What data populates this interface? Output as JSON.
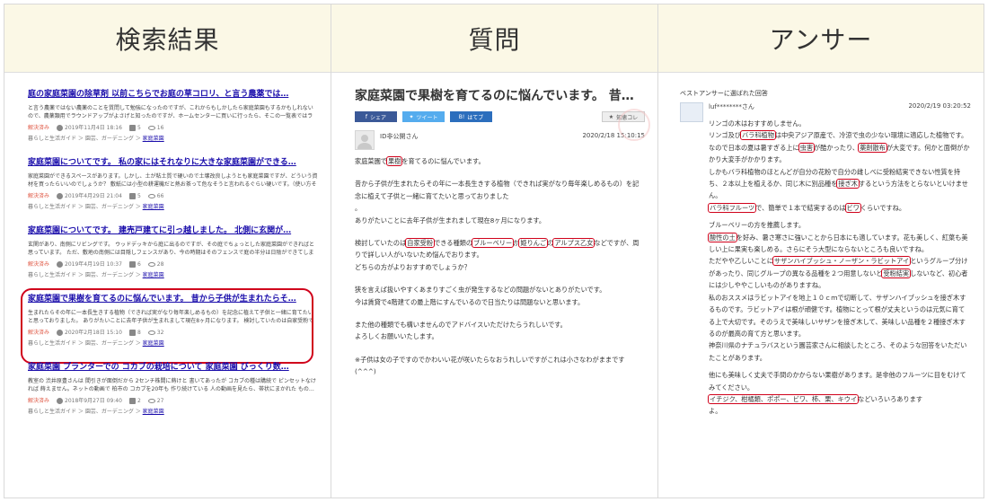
{
  "columns": {
    "results_title": "検索結果",
    "question_title": "質問",
    "answer_title": "アンサー"
  },
  "results": [
    {
      "title": "庭の家庭菜園の除草剤 以前こちらでお庭の草コロリ、と言う農薬では…",
      "snippet": "と言う農薬ではない農薬のことを質問して勉強になったのですが、これからもしかしたら家庭菜園もするかもしれないので、農薬類用でラウンドアップがよさげと知ったのですが、ホームセンターに買いに行ったら、そこの一覧表ではラウ…",
      "status": "解決済み",
      "date": "2019年11月4日 18:16",
      "answers": "5",
      "views": "16",
      "category_prefix": "暮らしと生活ガイド ＞ 園芸、ガーデニング ＞",
      "category_link": "家庭菜園"
    },
    {
      "title": "家庭菜園についてです。 私の家にはそれなりに大きな家庭菜園ができる…",
      "snippet": "家庭菜園ができるスペースがあります。しかし、土が粘土質で硬いので土壌改良しようとも家庭菜園ですが、どういう資材を買ったらいいのでしょうか？ 敷紙には小型の耕運機だと熱お茶って危なそうと言われるぐらい硬いです。（使い方その…",
      "status": "解決済み",
      "date": "2019年4月29日 21:04",
      "answers": "5",
      "views": "66",
      "category_prefix": "暮らしと生活ガイド ＞ 園芸、ガーデニング ＞",
      "category_link": "家庭菜園"
    },
    {
      "title": "家庭菜園についてです。 建売戸建てに引っ越しました。 北側に玄関が…",
      "snippet": "玄関があり、南側にリビングです。 ウッドデッキから庭に出るのですが、その庭でちょっとした家庭菜園ができればと思っています。 ただ、敷地の南側には目隠しフェンスがあり、今の時期はそのフェンスで庭の半分は日陰ができてしまいます…",
      "status": "解決済み",
      "date": "2019年4月19日 10:37",
      "answers": "6",
      "views": "28",
      "category_prefix": "暮らしと生活ガイド ＞ 園芸、ガーデニング ＞",
      "category_link": "家庭菜園"
    },
    {
      "title": "家庭菜園で果樹を育てるのに悩んでいます。 昔から子供が生まれたらそ…",
      "snippet": "生まれたらその年に一本長生きする植物（できれば実がなり毎年楽しめるもの）を記念に植えて子供と一緒に育てたいと思っておりました。 ありがたいことに去年子供が生まれまして現在8ヶ月になります。 検討していたのは自家受粉でき…",
      "status": "解決済み",
      "date": "2020年2月18日 15:10",
      "answers": "8",
      "views": "32",
      "category_prefix": "暮らしと生活ガイド ＞ 園芸、ガーデニング ＞",
      "category_link": "家庭菜園"
    },
    {
      "title": "家庭菜園 プランターでの コカブの栽培について 家庭菜園 びっくり数…",
      "snippet": "教室の 渋井原豊さんは 間引きが面倒だから 2センチ株間に蒔けと 書いてあったが コカブの種は購続で ピンセットなけ れば 蒔えません。ネットの動画で 柏市の コカブを20年も 作り続けている 人の動画を見たら、帯状にまかれた もの…",
      "status": "解決済み",
      "date": "2018年9月27日 09:40",
      "answers": "2",
      "views": "27",
      "category_prefix": "暮らしと生活ガイド ＞ 園芸、ガーデニング ＞",
      "category_link": "家庭菜園"
    }
  ],
  "question": {
    "title": "家庭菜園で果樹を育てるのに悩んでいます。 昔…",
    "share": {
      "facebook": "シェア",
      "twitter": "ツイート",
      "hatena": "はてブ",
      "save": "知恵コレ"
    },
    "username": "ID非公開さん",
    "date": "2020/2/18 15:10:15",
    "p1_pre": "家庭菜園で",
    "p1_box": "果樹",
    "p1_post": "を育てるのに悩んでいます。",
    "p2": "昔から子供が生まれたらその年に一本長生きする植物（できれば実がなり毎年楽しめるもの）を記念に植えて子供と一緒に育てたいと思っておりました",
    "p2b": "。",
    "p3": "ありがたいことに去年子供が生まれまして現在8ヶ月になります。",
    "p4_pre": "検討していたのは",
    "p4_box1": "自家受粉",
    "p4_mid1": "できる種類の",
    "p4_box2": "ブルーベリー",
    "p4_mid2": "か",
    "p4_box3": "姫りんご",
    "p4_mid3": "の",
    "p4_box4": "アルプス乙女",
    "p4_post": "などですが、周りで詳しい人がいないため悩んでおります。",
    "p4_tail": "どちらの方がよりおすすめでしょうか？",
    "p5": "狭を言えば扱いやすくあまりすごく虫が発生するなどの問題がないとありがたいです。",
    "p5b": "今は賃貸で4階建ての最上階にすんでいるので日当たりは問題ないと思います。",
    "p6": "また他の種類でも構いませんのでアドバイスいただけたらうれしいです。",
    "p6b": "よろしくお願いいたします。",
    "p7": "※子供は女の子ですのでかわいい花が咲いたらなおうれしいですがこれは小さなわがままです(^^^)"
  },
  "answer": {
    "label": "ベストアンサーに選ばれた回答",
    "username": "luf********さん",
    "date": "2020/2/19 03:20:52",
    "l1": "リンゴの木はおすすめしません。",
    "l2_pre": "リンゴ及び",
    "l2_box": "バラ科植物",
    "l2_post": "は中央アジア原産で、冷涼で虫の少ない環境に適応した植物です。なので日本の夏は暑すぎる上に",
    "l2_box2": "虫害",
    "l2_mid": "が酷かったり、",
    "l2_box3": "薬剤散布",
    "l2_post2": "が大変です。何かと面倒がかかり大変手がかかります。",
    "l3_pre": "しかもバラ科植物のほとんどが自分の花粉で自分の雌しべに受粉結実できない性質を持ち、２本以上を植えるか、同じ木に別品種を",
    "l3_box": "接ぎ木",
    "l3_post": "するという方法をとらないといけません。",
    "l4_box": "バラ科フルーツ",
    "l4_mid": "で、簡単で１本で結実するのは",
    "l4_box2": "ビワ",
    "l4_post": "くらいですね。",
    "l5": "ブルーベリーの方を推薦します。",
    "l6_box": "酸性の土",
    "l6_post": "を好み、暑さ寒さに強いことから日本にも適しています。花も美しく、紅葉も美しい上に果実も楽しめる。さらにそう大型にならないところも良いですね。",
    "l7_pre": "ただやや乙しいことに",
    "l7_box": "サザンハイブッシュ・ノーザン・ラビットアイ",
    "l7_mid": "というグループ分けがあったり、同じグループの異なる品種を２つ用意しないと",
    "l7_box2": "受粉結実",
    "l7_post": "しないなど、初心者には少しややこしいものがありますね。",
    "l8": "私のおススメはラビットアイを地上１０ｃｍで切断して、サザンハイブッシュを接ぎ木するものです。ラビットアイは根が頑健です。植物にとって根が丈夫というのは元気に育てる上で大切です。そのうえで美味しいサザンを接ぎ木して、美味しい品種を２種接ぎ木するのが最高の育て方と思います。",
    "l9": "神奈川県のナチュラバスという園芸家さんに相談したところ、そのような回答をいただいたことがあります。",
    "l10": "他にも美味しく丈夫で手間のかからない果樹があります。是非他のフルーツに目をむけてみてください。",
    "l11_box": "イチジク、柑橘類、ポポー、ビワ、柿、栗、キウイ",
    "l11_post": "などいろいろあります",
    "l11_tail": "よ。"
  },
  "colors": {
    "link": "#1a0dab",
    "highlight": "#d0021b",
    "header_bg": "#fbf8e6",
    "status": "#e05a47"
  }
}
